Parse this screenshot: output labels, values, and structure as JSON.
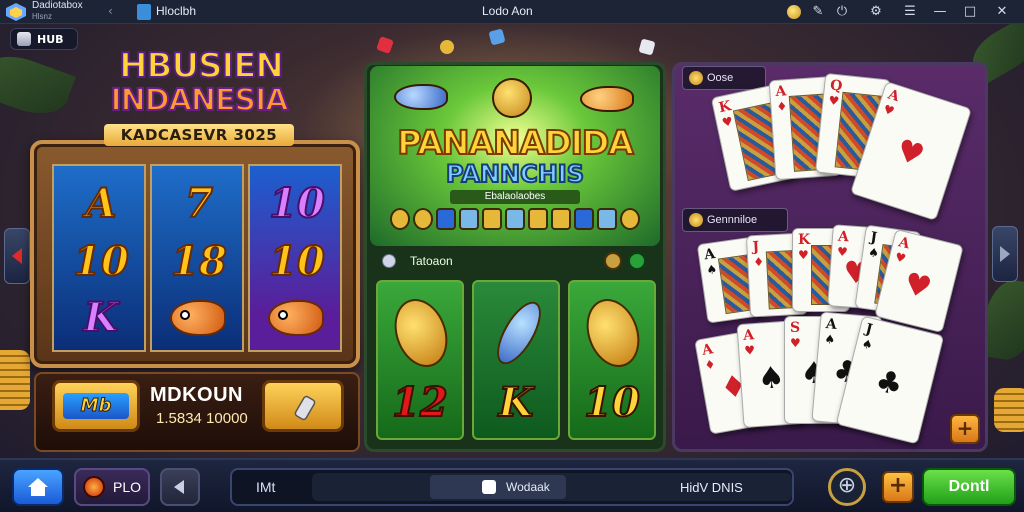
{
  "titlebar": {
    "app_line1": "Dadiotabox",
    "app_line2": "Hlsnz",
    "tab_label": "Hloclbh",
    "window_title": "Lodo Aon",
    "icons": [
      "coin-icon",
      "brush-icon",
      "power-icon",
      "settings-icon",
      "menu-icon",
      "minimize-icon",
      "maximize-icon",
      "close-icon"
    ]
  },
  "hub": {
    "label": "HUB"
  },
  "left_game": {
    "title_line1": "HBUSIEN",
    "title_line2": "INDANESIA",
    "subtitle": "KADCASEVR 3025",
    "reels": [
      [
        "A",
        "10",
        "K"
      ],
      [
        "7",
        "18",
        "fish"
      ],
      [
        "10",
        "10",
        "fish"
      ]
    ],
    "bottom_title": "MDKOUN",
    "bottom_value": "1.5834 10000",
    "button_left_label": "Mb"
  },
  "middle_game": {
    "title_line1": "PANANADIDA",
    "title_line2": "PANNCHIS",
    "subtitle": "Ebalaolaobes",
    "section_label": "Tatoaon",
    "items": [
      {
        "value": "12",
        "color": "#e0181a"
      },
      {
        "value": "K",
        "color": "#ffd43a"
      },
      {
        "value": "10",
        "color": "#ffd43a"
      }
    ]
  },
  "right_game": {
    "top_label": "Oose",
    "mid_label": "Gennniloe"
  },
  "bottombar": {
    "plo_label": "PLO",
    "field_left": "IMt",
    "pill_label": "Wodaak",
    "field_right": "HidV DNIS",
    "cta_label": "Dontl"
  },
  "colors": {
    "accent_gold": "#ffd43a",
    "cta_green": "#22a01a",
    "home_blue": "#1a5ad8",
    "titlebar": "#1c2436"
  }
}
